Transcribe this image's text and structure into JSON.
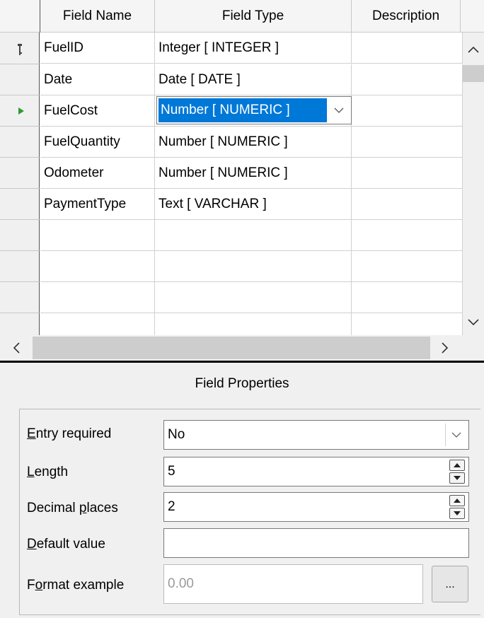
{
  "grid": {
    "columns": [
      "Field Name",
      "Field Type",
      "Description"
    ],
    "rows": [
      {
        "name": "FuelID",
        "type": "Integer [ INTEGER ]",
        "description": "",
        "marker": "key"
      },
      {
        "name": "Date",
        "type": "Date [ DATE ]",
        "description": "",
        "marker": ""
      },
      {
        "name": "FuelCost",
        "type": "Number [ NUMERIC ]",
        "description": "",
        "marker": "current"
      },
      {
        "name": "FuelQuantity",
        "type": "Number [ NUMERIC ]",
        "description": "",
        "marker": ""
      },
      {
        "name": "Odometer",
        "type": "Number [ NUMERIC ]",
        "description": "",
        "marker": ""
      },
      {
        "name": "PaymentType",
        "type": "Text [ VARCHAR ]",
        "description": "",
        "marker": ""
      }
    ],
    "selected_type": "Number [ NUMERIC ]"
  },
  "field_properties": {
    "title": "Field Properties",
    "entry_required": {
      "label_ul": "E",
      "label_rest": "ntry required",
      "value": "No"
    },
    "length": {
      "label_ul": "L",
      "label_rest": "ength",
      "value": "5"
    },
    "decimal_places": {
      "label_pre": "Decimal ",
      "label_ul": "p",
      "label_rest": "laces",
      "value": "2"
    },
    "default_value": {
      "label_ul": "D",
      "label_rest": "efault value",
      "value": ""
    },
    "format_example": {
      "label_pre": "F",
      "label_ul": "o",
      "label_rest": "rmat example",
      "value": "0.00",
      "button": "..."
    }
  },
  "colors": {
    "selection": "#0078d7",
    "current_row_marker": "#2e9d2e"
  },
  "icons": [
    "key-icon",
    "current-row-icon",
    "chevron-down-icon",
    "chevron-up-icon",
    "chevron-left-icon",
    "chevron-right-icon",
    "spin-up-icon",
    "spin-down-icon"
  ]
}
